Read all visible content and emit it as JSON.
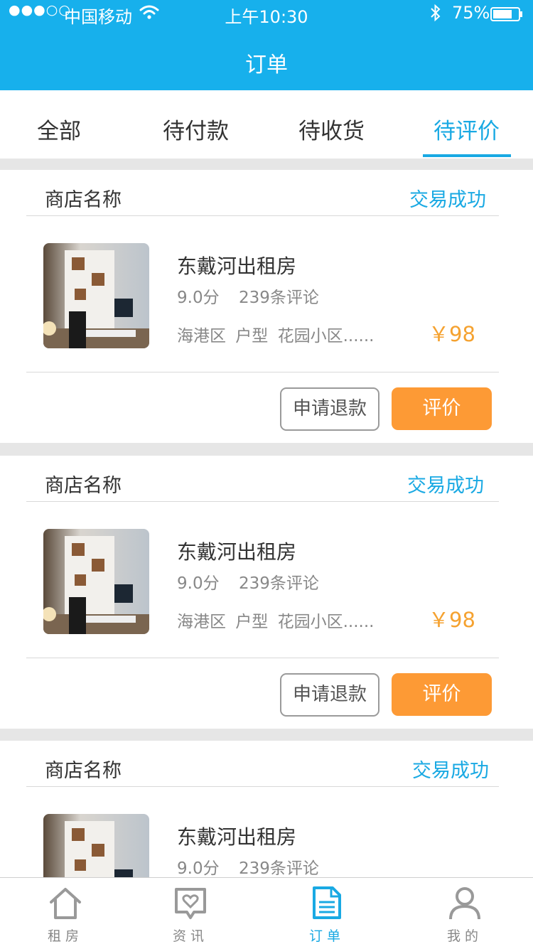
{
  "status_bar": {
    "signal": "●●●○○",
    "carrier": "中国移动",
    "time": "上午10:30",
    "battery": "75%"
  },
  "header": {
    "title": "订单"
  },
  "tabs": [
    {
      "label": "全部",
      "active": false
    },
    {
      "label": "待付款",
      "active": false
    },
    {
      "label": "待收货",
      "active": false
    },
    {
      "label": "待评价",
      "active": true
    }
  ],
  "orders": [
    {
      "shop": "商店名称",
      "status": "交易成功",
      "title": "东戴河出租房",
      "score": "9.0分",
      "reviews": "239条评论",
      "location": "海港区 户型 花园小区......",
      "price": "￥98",
      "refund_label": "申请退款",
      "review_label": "评价"
    },
    {
      "shop": "商店名称",
      "status": "交易成功",
      "title": "东戴河出租房",
      "score": "9.0分",
      "reviews": "239条评论",
      "location": "海港区 户型 花园小区......",
      "price": "￥98",
      "refund_label": "申请退款",
      "review_label": "评价"
    },
    {
      "shop": "商店名称",
      "status": "交易成功",
      "title": "东戴河出租房",
      "score": "9.0分",
      "reviews": "239条评论"
    }
  ],
  "bottom_nav": [
    {
      "label": "租房",
      "icon": "house-icon",
      "active": false
    },
    {
      "label": "资讯",
      "icon": "heart-chat-icon",
      "active": false
    },
    {
      "label": "订单",
      "icon": "document-icon",
      "active": true
    },
    {
      "label": "我的",
      "icon": "person-icon",
      "active": false
    }
  ],
  "colors": {
    "primary": "#17b0ec",
    "accent": "#19a9e3",
    "price": "#f5a230",
    "review_button": "#fd9a35"
  }
}
